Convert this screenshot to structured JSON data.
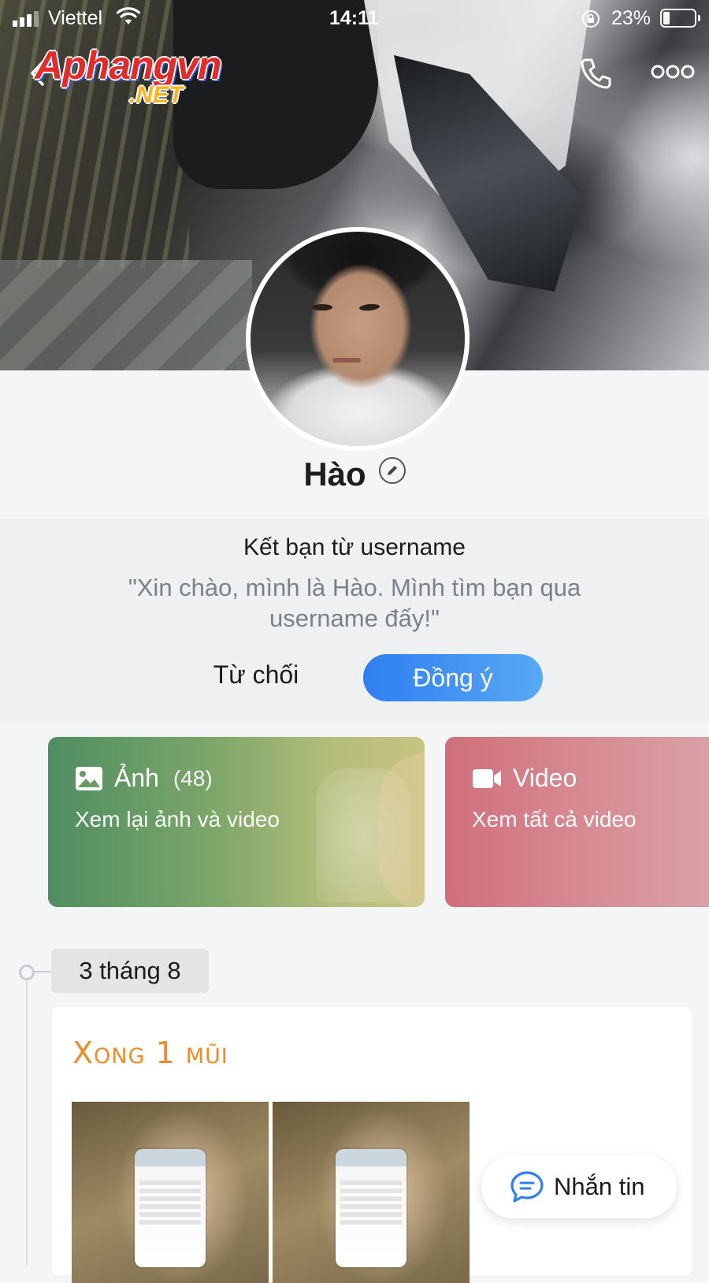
{
  "status_bar": {
    "carrier": "Viettel",
    "time": "14:11",
    "battery_percent": "23%",
    "battery_level": 0.23
  },
  "watermark": {
    "line1": "Aphangvn",
    "line2": ".NET"
  },
  "header": {
    "back_icon": "chevron-left-icon",
    "call_icon": "phone-icon",
    "more_icon": "more-dots-icon"
  },
  "profile": {
    "name": "Hào",
    "edit_icon": "pencil-icon"
  },
  "friend_request": {
    "title": "Kết bạn từ username",
    "message": "\"Xin chào, mình là Hào. Mình tìm bạn qua username đấy!\"",
    "reject_label": "Từ chối",
    "accept_label": "Đồng ý",
    "accent_color": "#3b8ef3"
  },
  "media": {
    "photos": {
      "title": "Ảnh",
      "count": "(48)",
      "subtitle": "Xem lại ảnh và video",
      "icon": "image-icon"
    },
    "videos": {
      "title": "Video",
      "subtitle": "Xem tất cả video",
      "icon": "video-camera-icon"
    }
  },
  "timeline": {
    "date_label": "3 tháng 8",
    "post": {
      "text": "Xong 1 mũi",
      "text_color": "#ef8b2c",
      "thumbnails": 2
    }
  },
  "fab": {
    "label": "Nhắn tin",
    "icon": "chat-bubble-icon"
  }
}
